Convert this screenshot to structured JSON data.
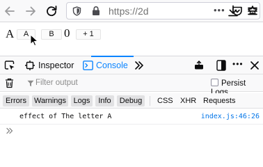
{
  "browser": {
    "url": "https://2d",
    "colors": {
      "toolbar": "#f9f9fa",
      "icon": "#0c0c0d",
      "accent": "#0a84ff"
    }
  },
  "page": {
    "letter": "A",
    "button_a": "A",
    "button_b": "B",
    "count": "0",
    "increment_button": "+ 1"
  },
  "devtools": {
    "tabs": {
      "inspector": "Inspector",
      "console": "Console"
    },
    "filter_placeholder": "Filter output",
    "persist_logs": "Persist Logs",
    "levels": [
      "Errors",
      "Warnings",
      "Logs",
      "Info",
      "Debug"
    ],
    "request_types": [
      "CSS",
      "XHR",
      "Requests"
    ],
    "log": {
      "message": "effect of The letter A",
      "source": "index.js:46:26"
    }
  }
}
